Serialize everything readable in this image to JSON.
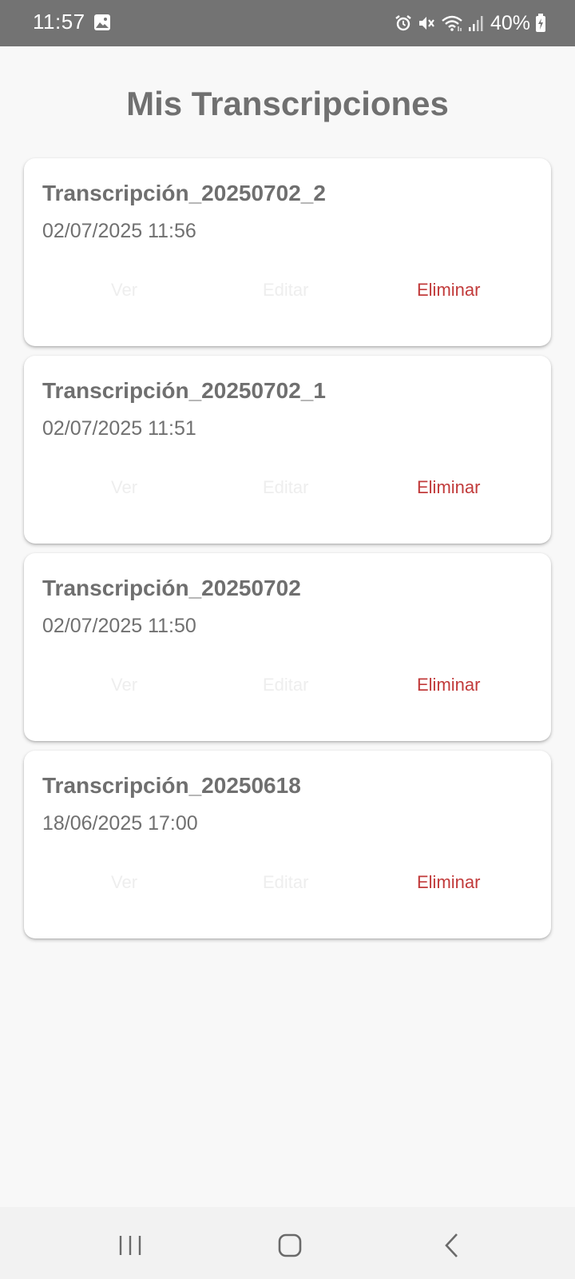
{
  "status_bar": {
    "time": "11:57",
    "battery": "40%",
    "icons": [
      "gallery-icon",
      "alarm-icon",
      "mute-icon",
      "wifi-icon",
      "signal-icon",
      "battery-icon"
    ]
  },
  "page": {
    "title": "Mis Transcripciones"
  },
  "transcriptions": [
    {
      "title": "Transcripción_20250702_2",
      "date": "02/07/2025 11:56",
      "view": "Ver",
      "edit": "Editar",
      "delete": "Eliminar"
    },
    {
      "title": "Transcripción_20250702_1",
      "date": "02/07/2025 11:51",
      "view": "Ver",
      "edit": "Editar",
      "delete": "Eliminar"
    },
    {
      "title": "Transcripción_20250702",
      "date": "02/07/2025 11:50",
      "view": "Ver",
      "edit": "Editar",
      "delete": "Eliminar"
    },
    {
      "title": "Transcripción_20250618",
      "date": "18/06/2025 17:00",
      "view": "Ver",
      "edit": "Editar",
      "delete": "Eliminar"
    }
  ],
  "colors": {
    "status_bar": "#737373",
    "background": "#f8f8f8",
    "title_text": "#707070",
    "delete_red": "#c13a3a",
    "disabled_button": "#eeeeee"
  },
  "nav_bar": {
    "icons": [
      "recent-apps-icon",
      "home-icon",
      "back-icon"
    ]
  }
}
